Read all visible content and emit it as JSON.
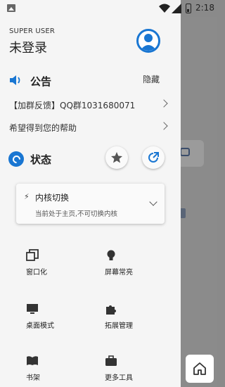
{
  "status_bar": {
    "time": "2:18"
  },
  "drawer": {
    "user_label": "SUPER USER",
    "user_name": "未登录",
    "notice": {
      "title": "公告",
      "hide_label": "隐藏",
      "links": [
        {
          "text": "【加群反馈】QQ群1031680071"
        },
        {
          "text": "希望得到您的帮助"
        }
      ]
    },
    "status": {
      "title": "状态"
    },
    "kernel": {
      "title": "内核切换",
      "subtitle": "当前处于主页,不可切换内核"
    },
    "menu": [
      {
        "label": "窗口化",
        "icon": "window-icon"
      },
      {
        "label": "屏幕常亮",
        "icon": "bulb-icon"
      },
      {
        "label": "桌面模式",
        "icon": "monitor-icon"
      },
      {
        "label": "拓展管理",
        "icon": "puzzle-icon"
      },
      {
        "label": "书架",
        "icon": "book-icon"
      },
      {
        "label": "更多工具",
        "icon": "toolbox-icon"
      }
    ]
  },
  "colors": {
    "accent": "#1976d2",
    "drawer_bg": "#f5f5f5",
    "scrim": "#8a8a8a"
  }
}
